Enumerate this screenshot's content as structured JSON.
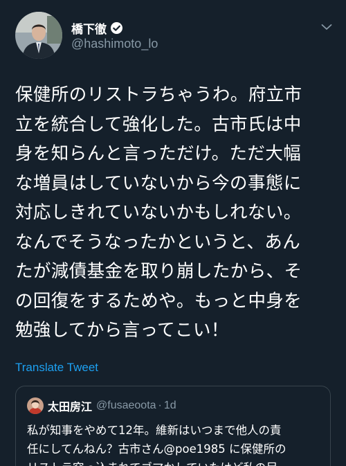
{
  "tweet": {
    "author": {
      "display_name": "橋下徹",
      "handle": "@hashimoto_lo",
      "avatar_icon": "person-photo-avatar",
      "verified_icon": "verified-badge-icon"
    },
    "menu_icon": "chevron-down-icon",
    "text_lines": [
      "保健所のリストラちゃうわ。府立市",
      "立を統合して強化した。古市氏は中",
      "身を知らんと言っただけ。ただ大幅",
      "な増員はしていないから今の事態に",
      "対応しきれていないかもしれない。",
      "なんでそうなったかというと、あん",
      "たが減債基金を取り崩したから、そ",
      "の回復をするためや。もっと中身を",
      "勉強してから言ってこい！"
    ],
    "translate_label": "Translate Tweet"
  },
  "quoted_tweet": {
    "author": {
      "display_name": "太田房江",
      "handle": "@fusaeoota",
      "separator": "·",
      "time": "1d"
    },
    "text_lines": [
      "私が知事をやめて12年。維新はいつまで他人の責",
      "任にしてんねん？古市さん@poe1985 に保健所の",
      "リストラ突っ込まれてゴマかしていたけど私の足"
    ]
  },
  "colors": {
    "background": "#15202b",
    "primary_text": "#ffffff",
    "secondary_text": "#8899a6",
    "link": "#1da1f2",
    "card_border": "#38444d"
  }
}
